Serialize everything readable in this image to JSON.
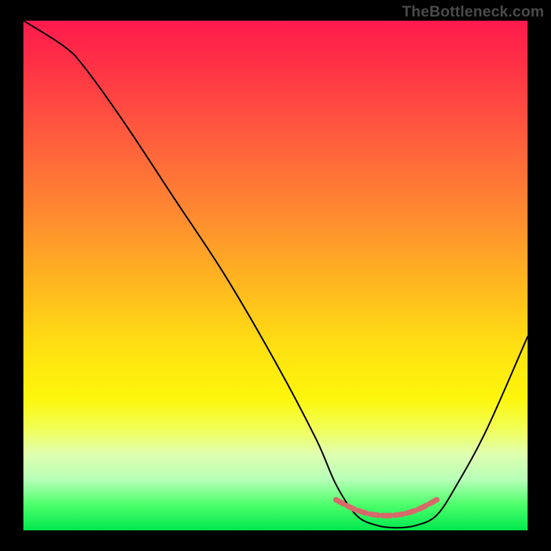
{
  "watermark": "TheBottleneck.com",
  "chart_data": {
    "type": "line",
    "title": "",
    "xlabel": "",
    "ylabel": "",
    "xlim": [
      0,
      100
    ],
    "ylim": [
      0,
      100
    ],
    "grid": false,
    "legend": false,
    "series": [
      {
        "name": "bottleneck-curve",
        "x": [
          0,
          8,
          12,
          20,
          30,
          40,
          50,
          58,
          62,
          66,
          70,
          74,
          78,
          82,
          86,
          92,
          100
        ],
        "values": [
          100,
          95,
          91,
          80,
          65,
          50,
          33,
          18,
          9,
          3,
          1,
          0.5,
          1,
          3,
          9,
          20,
          38
        ]
      },
      {
        "name": "optimal-band-marker",
        "x": [
          62,
          66,
          70,
          74,
          78,
          82
        ],
        "values": [
          6,
          4,
          3,
          3,
          4,
          6
        ]
      }
    ],
    "colors": {
      "curve": "#000000",
      "marker": "#d66a6a",
      "gradient_top": "#ff1a4d",
      "gradient_mid_orange": "#ff8a30",
      "gradient_mid_yellow": "#ffe012",
      "gradient_bottom": "#00e84e",
      "background": "#000000",
      "watermark": "#4a4a4a"
    }
  }
}
